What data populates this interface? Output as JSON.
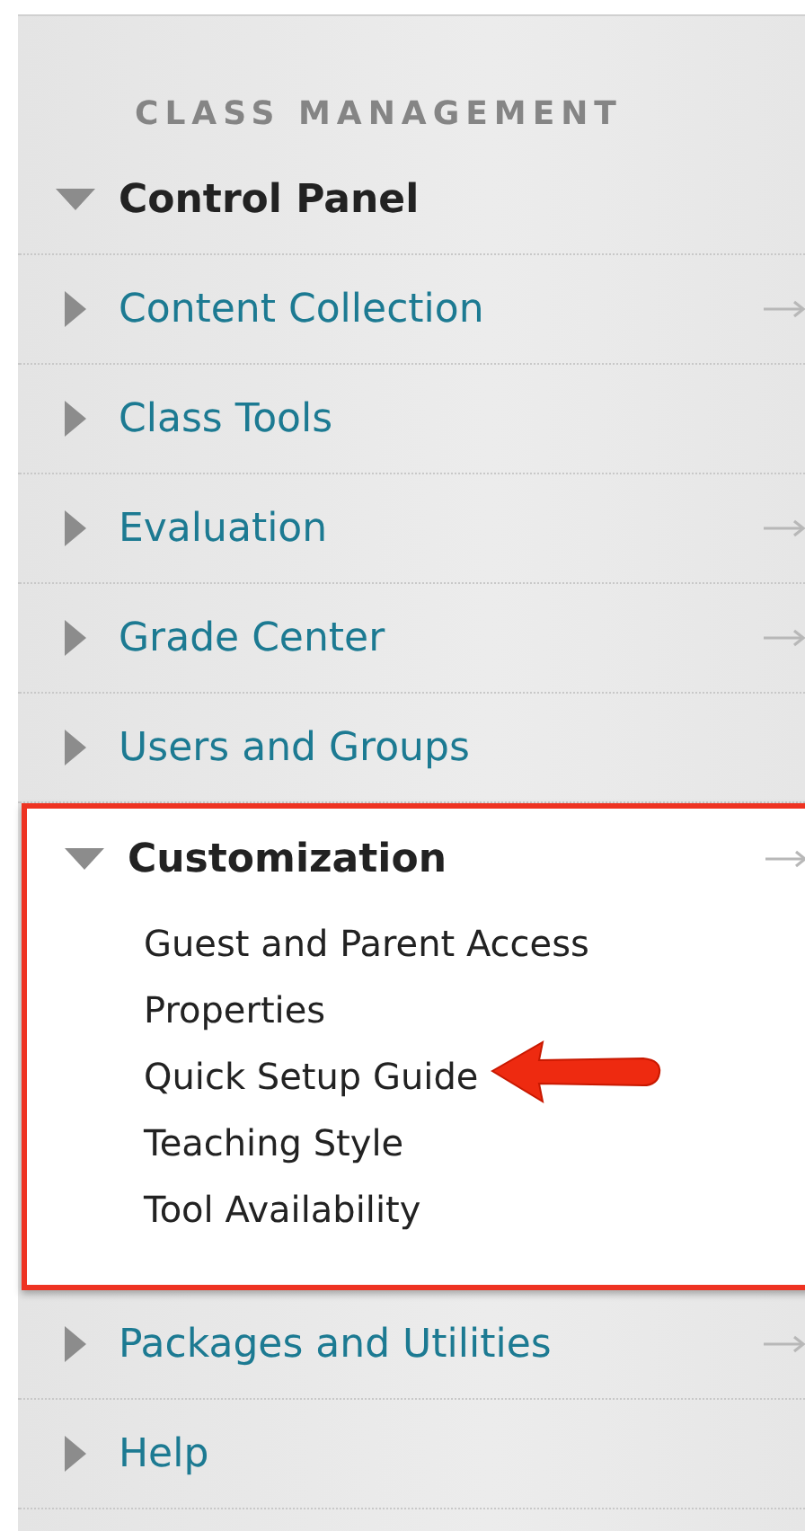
{
  "section_title": "CLASS MANAGEMENT",
  "items": [
    {
      "label": "Control Panel",
      "expanded": true,
      "link_arrow": false,
      "highlighted": false
    },
    {
      "label": "Content Collection",
      "expanded": false,
      "link_arrow": true,
      "highlighted": false
    },
    {
      "label": "Class Tools",
      "expanded": false,
      "link_arrow": false,
      "highlighted": false
    },
    {
      "label": "Evaluation",
      "expanded": false,
      "link_arrow": true,
      "highlighted": false
    },
    {
      "label": "Grade Center",
      "expanded": false,
      "link_arrow": true,
      "highlighted": false
    },
    {
      "label": "Users and Groups",
      "expanded": false,
      "link_arrow": false,
      "highlighted": false
    },
    {
      "label": "Customization",
      "expanded": true,
      "link_arrow": true,
      "highlighted": true,
      "children": [
        {
          "label": "Guest and Parent Access",
          "pointed": false
        },
        {
          "label": "Properties",
          "pointed": false
        },
        {
          "label": "Quick Setup Guide",
          "pointed": true
        },
        {
          "label": "Teaching Style",
          "pointed": false
        },
        {
          "label": "Tool Availability",
          "pointed": false
        }
      ]
    },
    {
      "label": "Packages and Utilities",
      "expanded": false,
      "link_arrow": true,
      "highlighted": false
    },
    {
      "label": "Help",
      "expanded": false,
      "link_arrow": false,
      "highlighted": false
    }
  ]
}
